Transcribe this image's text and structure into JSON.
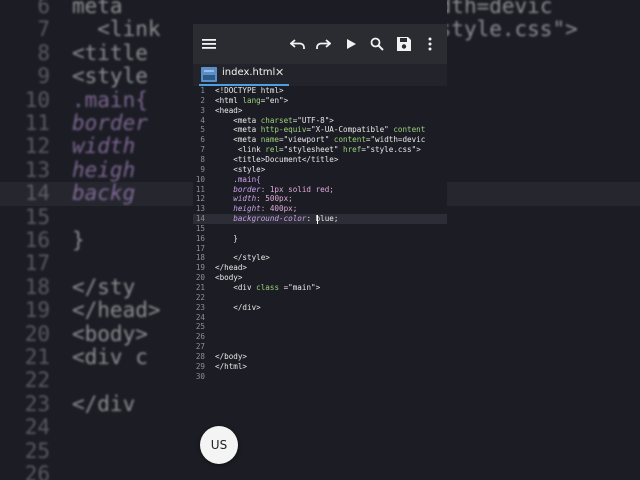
{
  "tab": {
    "label": "index.html",
    "close": "✕"
  },
  "avatar": {
    "label": "US"
  },
  "code_lines": [
    {
      "n": "1",
      "segs": [
        {
          "t": "<!DOCTYPE html>",
          "c": ""
        }
      ]
    },
    {
      "n": "2",
      "segs": [
        {
          "t": "<html ",
          "c": ""
        },
        {
          "t": "lang",
          "c": "c-attr"
        },
        {
          "t": "=\"en\">",
          "c": ""
        }
      ]
    },
    {
      "n": "3",
      "segs": [
        {
          "t": "<head>",
          "c": ""
        }
      ]
    },
    {
      "n": "4",
      "segs": [
        {
          "t": "    <meta ",
          "c": ""
        },
        {
          "t": "charset",
          "c": "c-attr"
        },
        {
          "t": "=\"UTF-8\">",
          "c": ""
        }
      ]
    },
    {
      "n": "5",
      "segs": [
        {
          "t": "    <meta ",
          "c": ""
        },
        {
          "t": "http-equiv",
          "c": "c-attr"
        },
        {
          "t": "=\"X-UA-Compatible\" ",
          "c": ""
        },
        {
          "t": "content",
          "c": "c-attr"
        }
      ]
    },
    {
      "n": "6",
      "segs": [
        {
          "t": "    <meta ",
          "c": ""
        },
        {
          "t": "name",
          "c": "c-attr"
        },
        {
          "t": "=\"viewport\" ",
          "c": ""
        },
        {
          "t": "content",
          "c": "c-attr"
        },
        {
          "t": "=\"width=devic",
          "c": ""
        }
      ]
    },
    {
      "n": "7",
      "segs": [
        {
          "t": "     <link ",
          "c": ""
        },
        {
          "t": "rel",
          "c": "c-attr"
        },
        {
          "t": "=\"stylesheet\" ",
          "c": ""
        },
        {
          "t": "href",
          "c": "c-attr"
        },
        {
          "t": "=\"style.css\">",
          "c": ""
        }
      ]
    },
    {
      "n": "8",
      "segs": [
        {
          "t": "    <title>Document</title>",
          "c": ""
        }
      ]
    },
    {
      "n": "9",
      "segs": [
        {
          "t": "    <style>",
          "c": ""
        }
      ]
    },
    {
      "n": "10",
      "segs": [
        {
          "t": "    .main{",
          "c": "c-sel"
        }
      ]
    },
    {
      "n": "11",
      "segs": [
        {
          "t": "    border",
          "c": "c-prop"
        },
        {
          "t": ": 1px solid red;",
          "c": "c-num"
        }
      ]
    },
    {
      "n": "12",
      "segs": [
        {
          "t": "    width",
          "c": "c-prop"
        },
        {
          "t": ": 500px;",
          "c": "c-num"
        }
      ]
    },
    {
      "n": "13",
      "segs": [
        {
          "t": "    height",
          "c": "c-prop"
        },
        {
          "t": ": 400px;",
          "c": "c-num"
        }
      ]
    },
    {
      "n": "14",
      "segs": [
        {
          "t": "    background-color",
          "c": "c-prop"
        },
        {
          "t": ": blue;",
          "c": ""
        }
      ]
    },
    {
      "n": "15",
      "segs": [
        {
          "t": "",
          "c": ""
        }
      ]
    },
    {
      "n": "16",
      "segs": [
        {
          "t": "    }",
          "c": ""
        }
      ]
    },
    {
      "n": "17",
      "segs": [
        {
          "t": "",
          "c": ""
        }
      ]
    },
    {
      "n": "18",
      "segs": [
        {
          "t": "    </style>",
          "c": ""
        }
      ]
    },
    {
      "n": "19",
      "segs": [
        {
          "t": "</head>",
          "c": ""
        }
      ]
    },
    {
      "n": "20",
      "segs": [
        {
          "t": "<body>",
          "c": ""
        }
      ]
    },
    {
      "n": "21",
      "segs": [
        {
          "t": "    <div ",
          "c": ""
        },
        {
          "t": "class",
          "c": "c-attr"
        },
        {
          "t": " =\"main\">",
          "c": ""
        }
      ]
    },
    {
      "n": "22",
      "segs": [
        {
          "t": "",
          "c": ""
        }
      ]
    },
    {
      "n": "23",
      "segs": [
        {
          "t": "    </div>",
          "c": ""
        }
      ]
    },
    {
      "n": "24",
      "segs": [
        {
          "t": "",
          "c": ""
        }
      ]
    },
    {
      "n": "25",
      "segs": [
        {
          "t": "",
          "c": ""
        }
      ]
    },
    {
      "n": "26",
      "segs": [
        {
          "t": "",
          "c": ""
        }
      ]
    },
    {
      "n": "27",
      "segs": [
        {
          "t": "",
          "c": ""
        }
      ]
    },
    {
      "n": "28",
      "segs": [
        {
          "t": "</body>",
          "c": ""
        }
      ]
    },
    {
      "n": "29",
      "segs": [
        {
          "t": "</html>",
          "c": ""
        }
      ]
    },
    {
      "n": "30",
      "segs": [
        {
          "t": "",
          "c": ""
        }
      ]
    }
  ],
  "bg_lines": [
    {
      "n": "6",
      "segs": [
        {
          "t": "meta",
          "c": ""
        },
        {
          "t": "                    ",
          "c": ""
        },
        {
          "t": "t=\"width=devic",
          "c": ""
        }
      ]
    },
    {
      "n": "7",
      "segs": [
        {
          "t": "  <link",
          "c": ""
        },
        {
          "t": "                   ",
          "c": ""
        },
        {
          "t": "f=\"style.css\">",
          "c": ""
        }
      ]
    },
    {
      "n": "8",
      "segs": [
        {
          "t": "<title",
          "c": ""
        }
      ]
    },
    {
      "n": "9",
      "segs": [
        {
          "t": "<style",
          "c": ""
        }
      ]
    },
    {
      "n": "10",
      "segs": [
        {
          "t": ".main{",
          "c": "c-sel"
        }
      ]
    },
    {
      "n": "11",
      "segs": [
        {
          "t": "border",
          "c": "c-prop"
        }
      ]
    },
    {
      "n": "12",
      "segs": [
        {
          "t": "width",
          "c": "c-prop"
        }
      ]
    },
    {
      "n": "13",
      "segs": [
        {
          "t": "heigh",
          "c": "c-prop"
        }
      ]
    },
    {
      "n": "14",
      "segs": [
        {
          "t": "backg",
          "c": "c-prop"
        }
      ]
    },
    {
      "n": "15",
      "segs": [
        {
          "t": "",
          "c": ""
        }
      ]
    },
    {
      "n": "16",
      "segs": [
        {
          "t": "}",
          "c": ""
        }
      ]
    },
    {
      "n": "17",
      "segs": [
        {
          "t": "",
          "c": ""
        }
      ]
    },
    {
      "n": "18",
      "segs": [
        {
          "t": "</sty",
          "c": ""
        }
      ]
    },
    {
      "n": "19",
      "segs": [
        {
          "t": "</head>",
          "c": ""
        }
      ]
    },
    {
      "n": "20",
      "segs": [
        {
          "t": "<body>",
          "c": ""
        }
      ]
    },
    {
      "n": "21",
      "segs": [
        {
          "t": "<div c",
          "c": ""
        }
      ]
    },
    {
      "n": "22",
      "segs": [
        {
          "t": "",
          "c": ""
        }
      ]
    },
    {
      "n": "23",
      "segs": [
        {
          "t": "</div",
          "c": ""
        }
      ]
    },
    {
      "n": "24",
      "segs": [
        {
          "t": "",
          "c": ""
        }
      ]
    },
    {
      "n": "25",
      "segs": [
        {
          "t": "",
          "c": ""
        }
      ]
    },
    {
      "n": "26",
      "segs": [
        {
          "t": "",
          "c": ""
        }
      ]
    }
  ]
}
